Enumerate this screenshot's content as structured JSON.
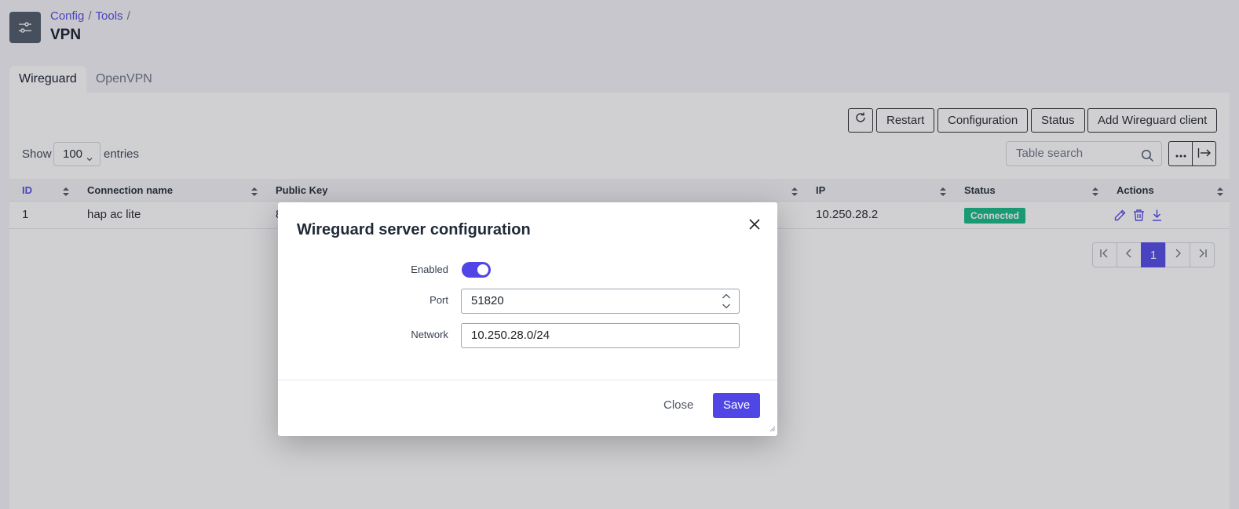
{
  "breadcrumb": [
    "Config",
    "Tools"
  ],
  "breadcrumb_sep": "/",
  "page_title": "VPN",
  "tabs": [
    {
      "label": "Wireguard",
      "active": true
    },
    {
      "label": "OpenVPN",
      "active": false
    }
  ],
  "toolbar": {
    "restart": "Restart",
    "configuration": "Configuration",
    "status": "Status",
    "add_client": "Add Wireguard client"
  },
  "entries": {
    "show": "Show",
    "value": "100",
    "suffix": "entries"
  },
  "search": {
    "placeholder": "Table search"
  },
  "table": {
    "headers": [
      "ID",
      "Connection name",
      "Public Key",
      "IP",
      "Status",
      "Actions"
    ],
    "rows": [
      {
        "id": "1",
        "name": "hap ac lite",
        "public_key": "8",
        "ip": "10.250.28.2",
        "status": "Connected"
      }
    ]
  },
  "pagination": {
    "current": "1"
  },
  "modal": {
    "title": "Wireguard server configuration",
    "enabled_label": "Enabled",
    "enabled": true,
    "port_label": "Port",
    "port_value": "51820",
    "network_label": "Network",
    "network_value": "10.250.28.0/24",
    "close": "Close",
    "save": "Save"
  },
  "colors": {
    "accent": "#4f46e5",
    "success": "#10b981",
    "app_icon_bg": "#4b5563"
  }
}
